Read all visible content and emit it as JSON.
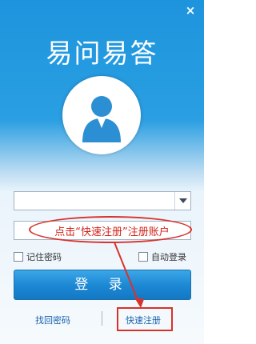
{
  "window": {
    "title": "易问易答",
    "close_glyph": "×"
  },
  "avatar": {
    "icon": "user-silhouette-icon"
  },
  "form": {
    "account_value": "",
    "password_value": "",
    "remember_label": "记住密码",
    "autologin_label": "自动登录",
    "login_label": "登 录"
  },
  "links": {
    "retrieve_label": "找回密码",
    "register_label": "快速注册"
  },
  "annotation": {
    "text": "点击“快速注册”注册账户",
    "color": "#d8322b"
  },
  "colors": {
    "header_blue": "#1d94dd",
    "button_blue": "#1b87d3",
    "link_blue": "#1a63b0"
  }
}
